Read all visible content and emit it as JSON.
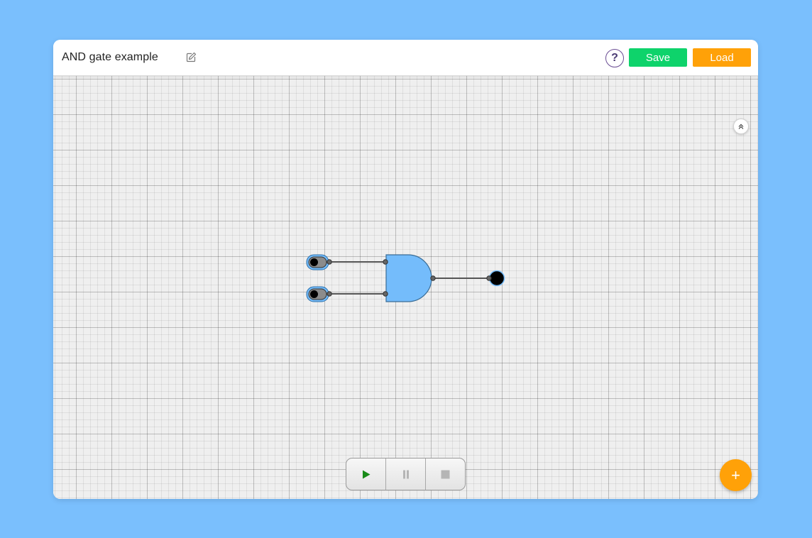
{
  "header": {
    "title": "AND gate example",
    "help_label": "?",
    "save_label": "Save",
    "load_label": "Load"
  },
  "fab": {
    "label": "+"
  },
  "colors": {
    "background": "#7abffd",
    "save": "#0ed36b",
    "load": "#ffa108",
    "gate_fill": "#74bcfb",
    "play": "#188a18"
  },
  "icons": {
    "edit": "pencil-edit-icon",
    "collapse": "double-chevron-up-icon",
    "play": "play-icon",
    "pause": "pause-icon",
    "stop": "stop-icon"
  },
  "circuit": {
    "inputs": [
      {
        "name": "input-1",
        "state": "off"
      },
      {
        "name": "input-2",
        "state": "off"
      }
    ],
    "gate": {
      "type": "AND"
    },
    "output": {
      "name": "output",
      "state": "off"
    }
  }
}
